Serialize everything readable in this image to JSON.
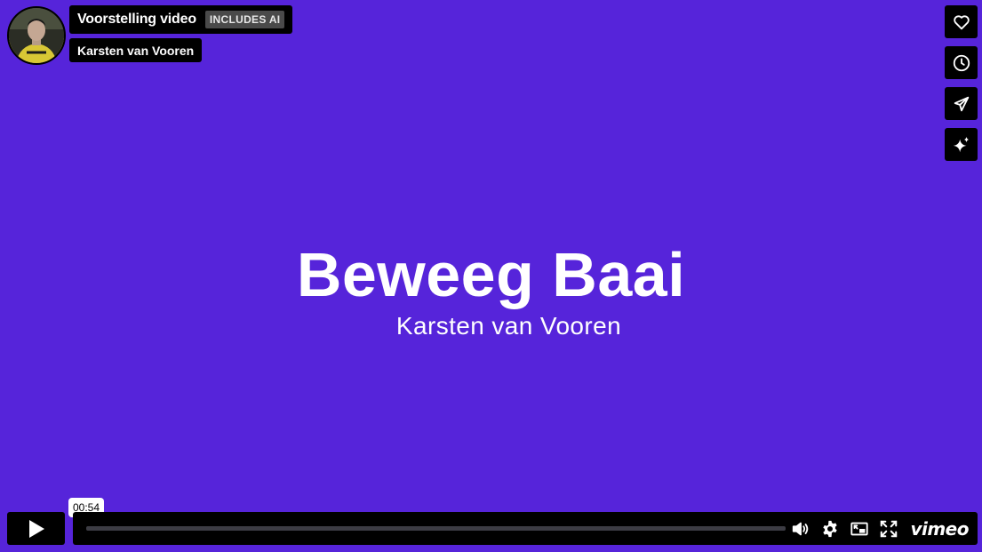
{
  "header": {
    "title": "Voorstelling video",
    "badge": "INCLUDES AI",
    "author": "Karsten van Vooren"
  },
  "side_actions": [
    {
      "name": "like",
      "icon": "heart-icon"
    },
    {
      "name": "watch-later",
      "icon": "clock-icon"
    },
    {
      "name": "share",
      "icon": "paper-plane-icon"
    },
    {
      "name": "ai-features",
      "icon": "sparkle-icon"
    }
  ],
  "video": {
    "title_card": "Beweeg Baai",
    "subtitle_card": "Karsten van Vooren",
    "background_color": "#5624da"
  },
  "controls": {
    "time_tooltip": "00:54",
    "progress_fraction": 0.0,
    "icons": [
      "play-icon",
      "volume-icon",
      "settings-icon",
      "picture-in-picture-icon",
      "fullscreen-icon"
    ],
    "brand": "vimeo"
  }
}
